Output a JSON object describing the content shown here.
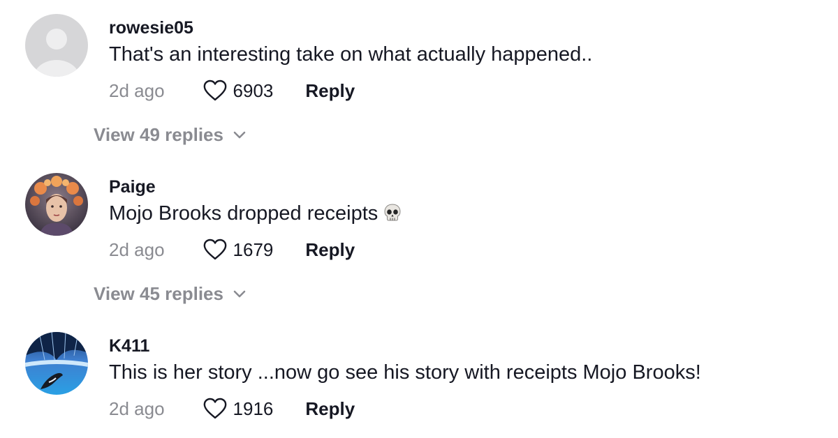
{
  "comments": [
    {
      "username": "rowesie05",
      "text": "That's an interesting take on what actually happened..",
      "time": "2d ago",
      "likes": "6903",
      "reply_label": "Reply",
      "avatar": "default-avatar-icon",
      "view_replies": "View 49 replies"
    },
    {
      "username": "Paige",
      "text": "Mojo Brooks dropped receipts",
      "emoji": "skull-emoji",
      "time": "2d ago",
      "likes": "1679",
      "reply_label": "Reply",
      "avatar": "illustrated-woman-avatar",
      "view_replies": "View 45 replies"
    },
    {
      "username": "K411",
      "text": "This is her story ...now go see his story with receipts Mojo Brooks!",
      "time": "2d ago",
      "likes": "1916",
      "reply_label": "Reply",
      "avatar": "ocean-orca-avatar"
    }
  ],
  "colors": {
    "primary_text": "#161823",
    "secondary_text": "#8a8b91",
    "background": "#ffffff"
  },
  "icons": {
    "like": "heart-outline-icon",
    "expand": "chevron-down-icon"
  }
}
